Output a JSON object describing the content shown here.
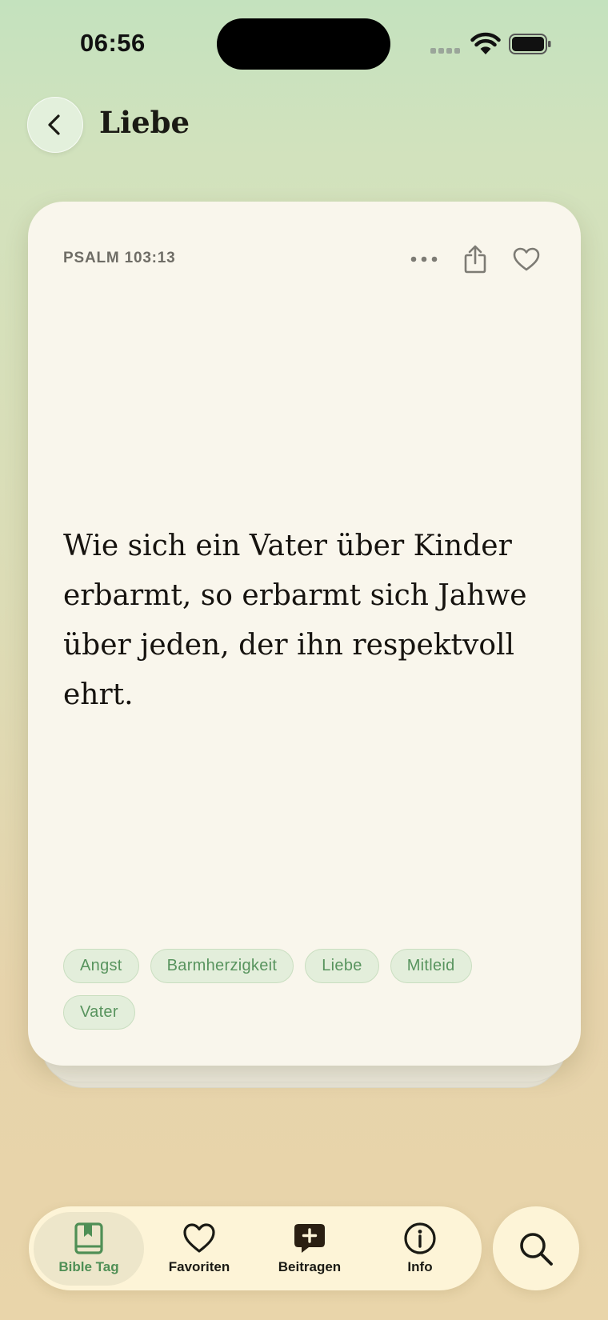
{
  "status_bar": {
    "time": "06:56"
  },
  "header": {
    "title": "Liebe",
    "back_icon": "chevron-left-icon"
  },
  "card": {
    "reference": "PSALM 103:13",
    "text": "Wie sich ein Vater über Kinder erbarmt, so erbarmt sich Jahwe über jeden, der ihn respektvoll ehrt.",
    "actions": [
      "more-icon",
      "share-icon",
      "heart-icon"
    ],
    "tags": [
      "Angst",
      "Barmherzigkeit",
      "Liebe",
      "Mitleid",
      "Vater"
    ]
  },
  "tab_bar": {
    "items": [
      {
        "label": "Bible Tag",
        "icon": "bookmark-book-icon",
        "active": true
      },
      {
        "label": "Favoriten",
        "icon": "heart-icon",
        "active": false
      },
      {
        "label": "Beitragen",
        "icon": "plus-bubble-icon",
        "active": false
      },
      {
        "label": "Info",
        "icon": "info-icon",
        "active": false
      }
    ],
    "search_icon": "search-icon"
  },
  "colors": {
    "accent": "#4f8f55",
    "card_background": "#f9f6ec",
    "tab_bar_background": "#fdf4d7"
  }
}
